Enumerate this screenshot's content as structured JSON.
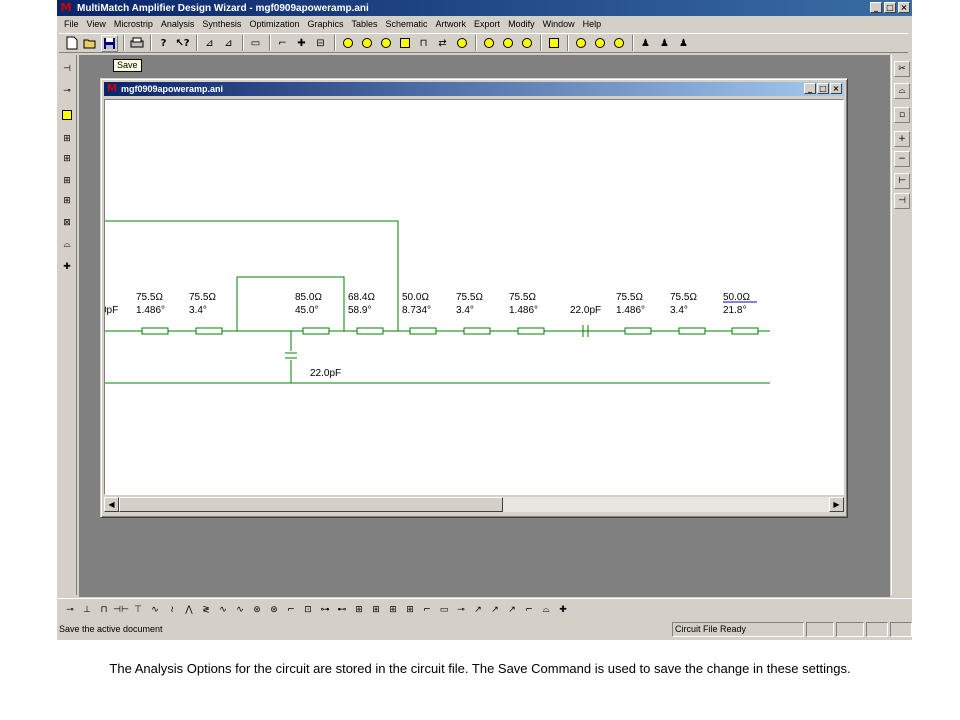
{
  "app": {
    "title": "MultiMatch Amplifier Design Wizard - mgf0909apoweramp.ani",
    "logo": "M",
    "win_buttons": [
      "_",
      "□",
      "×"
    ]
  },
  "menu": [
    "File",
    "View",
    "Microstrip",
    "Analysis",
    "Synthesis",
    "Optimization",
    "Graphics",
    "Tables",
    "Schematic",
    "Artwork",
    "Export",
    "Modify",
    "Window",
    "Help"
  ],
  "tooltip": "Save",
  "toolbar_icons": [
    "new-file-icon",
    "open-folder-icon",
    "save-disk-icon",
    "print-icon",
    "help-icon",
    "context-help-icon"
  ],
  "doc": {
    "title": "mgf0909apoweramp.ani",
    "logo": "M",
    "buttons": [
      "_",
      "□",
      "×"
    ]
  },
  "schematic": {
    "line_color": "#008000",
    "element_labels": [
      {
        "impedance": "0pF",
        "angle": ""
      },
      {
        "impedance": "75.5Ω",
        "angle": "1.486°"
      },
      {
        "impedance": "75.5Ω",
        "angle": "3.4°"
      },
      {
        "impedance": "85.0Ω",
        "angle": "45.0°"
      },
      {
        "impedance": "68.4Ω",
        "angle": "58.9°"
      },
      {
        "impedance": "50.0Ω",
        "angle": "8.734°"
      },
      {
        "impedance": "75.5Ω",
        "angle": "3.4°"
      },
      {
        "impedance": "75.5Ω",
        "angle": "1.486°"
      },
      {
        "impedance": "22.0pF",
        "angle": ""
      },
      {
        "impedance": "75.5Ω",
        "angle": "1.486°"
      },
      {
        "impedance": "75.5Ω",
        "angle": "3.4°"
      },
      {
        "impedance": "50.0Ω",
        "angle": "21.8°"
      }
    ],
    "shunt_cap_label": "22.0pF"
  },
  "statusbar": {
    "message": "Save the active document",
    "state": "Circuit File Ready"
  },
  "caption": "The Analysis Options for the circuit are stored in the circuit file. The Save Command is used to save the change in these settings."
}
